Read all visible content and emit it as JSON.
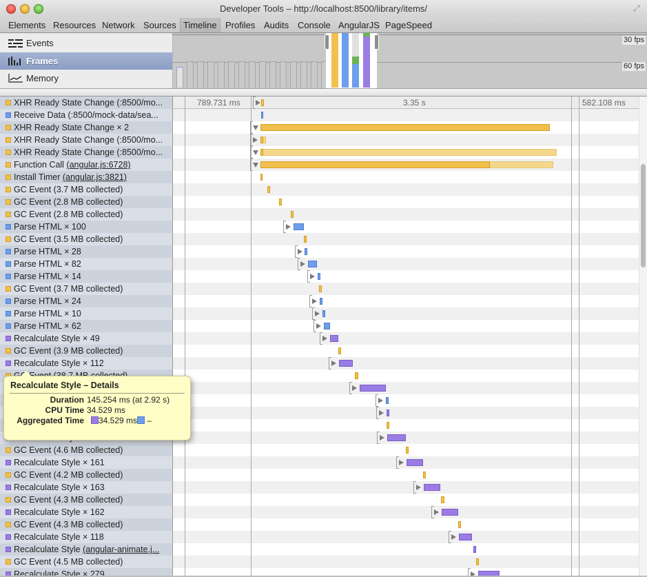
{
  "window": {
    "title": "Developer Tools – http://localhost:8500/library/items/"
  },
  "tabs": [
    {
      "label": "Elements",
      "active": false
    },
    {
      "label": "Resources",
      "active": false
    },
    {
      "label": "Network",
      "active": false
    },
    {
      "label": "Sources",
      "active": false
    },
    {
      "label": "Timeline",
      "active": true
    },
    {
      "label": "Profiles",
      "active": false
    },
    {
      "label": "Audits",
      "active": false
    },
    {
      "label": "Console",
      "active": false
    },
    {
      "label": "AngularJS",
      "active": false
    },
    {
      "label": "PageSpeed",
      "active": false
    }
  ],
  "overview": {
    "items": [
      {
        "label": "Events",
        "icon": "events-icon",
        "selected": false
      },
      {
        "label": "Frames",
        "icon": "frames-icon",
        "selected": true
      },
      {
        "label": "Memory",
        "icon": "memory-icon",
        "selected": false
      }
    ],
    "fps_labels": [
      "30 fps",
      "60 fps"
    ]
  },
  "colors": {
    "loading": "#6d9eeb",
    "scripting": "#f2c04e",
    "rendering": "#9a7ce5",
    "painting": "#6cb453",
    "row_alt": "#cdd3dc",
    "selected_item": "#8b9dc3",
    "tooltip_bg": "#fefec6"
  },
  "ruler": {
    "left_label": "789.731 ms",
    "center_label": "3.35 s",
    "right_label": "582.108 ms"
  },
  "records": [
    {
      "category": "scripting",
      "text": "XHR Ready State Change (:8500/mo...",
      "link": ""
    },
    {
      "category": "loading",
      "text": "Receive Data (:8500/mock-data/sea...",
      "link": ""
    },
    {
      "category": "scripting",
      "text": "XHR Ready State Change × 2",
      "link": ""
    },
    {
      "category": "scripting",
      "text": "XHR Ready State Change (:8500/mo...",
      "link": ""
    },
    {
      "category": "scripting",
      "text": "XHR Ready State Change (:8500/mo...",
      "link": ""
    },
    {
      "category": "scripting",
      "text": "Function Call ",
      "link": "(angular.js:6728)"
    },
    {
      "category": "scripting",
      "text": "Install Timer ",
      "link": "(angular.js:3821)"
    },
    {
      "category": "scripting",
      "text": "GC Event (3.7 MB collected)",
      "link": ""
    },
    {
      "category": "scripting",
      "text": "GC Event (2.8 MB collected)",
      "link": ""
    },
    {
      "category": "scripting",
      "text": "GC Event (2.8 MB collected)",
      "link": ""
    },
    {
      "category": "loading",
      "text": "Parse HTML × 100",
      "link": ""
    },
    {
      "category": "scripting",
      "text": "GC Event (3.5 MB collected)",
      "link": ""
    },
    {
      "category": "loading",
      "text": "Parse HTML × 28",
      "link": ""
    },
    {
      "category": "loading",
      "text": "Parse HTML × 82",
      "link": ""
    },
    {
      "category": "loading",
      "text": "Parse HTML × 14",
      "link": ""
    },
    {
      "category": "scripting",
      "text": "GC Event (3.7 MB collected)",
      "link": ""
    },
    {
      "category": "loading",
      "text": "Parse HTML × 24",
      "link": ""
    },
    {
      "category": "loading",
      "text": "Parse HTML × 10",
      "link": ""
    },
    {
      "category": "loading",
      "text": "Parse HTML × 62",
      "link": ""
    },
    {
      "category": "rendering",
      "text": "Recalculate Style × 49",
      "link": ""
    },
    {
      "category": "scripting",
      "text": "GC Event (3.9 MB collected)",
      "link": ""
    },
    {
      "category": "rendering",
      "text": "Recalculate Style × 112",
      "link": ""
    },
    {
      "category": "scripting",
      "text": "GC Event (38.7 MB collected)",
      "link": ""
    },
    {
      "category": "rendering",
      "text": "",
      "link": ""
    },
    {
      "category": "loading",
      "text": "",
      "link": ""
    },
    {
      "category": "rendering",
      "text": "",
      "link": ""
    },
    {
      "category": "scripting",
      "text": "",
      "link": ""
    },
    {
      "category": "rendering",
      "text": "Recalculate Style × 172",
      "link": ""
    },
    {
      "category": "scripting",
      "text": "GC Event (4.6 MB collected)",
      "link": ""
    },
    {
      "category": "rendering",
      "text": "Recalculate Style × 161",
      "link": ""
    },
    {
      "category": "scripting",
      "text": "GC Event (4.2 MB collected)",
      "link": ""
    },
    {
      "category": "rendering",
      "text": "Recalculate Style × 163",
      "link": ""
    },
    {
      "category": "scripting",
      "text": "GC Event (4.3 MB collected)",
      "link": ""
    },
    {
      "category": "rendering",
      "text": "Recalculate Style × 162",
      "link": ""
    },
    {
      "category": "scripting",
      "text": "GC Event (4.3 MB collected)",
      "link": ""
    },
    {
      "category": "rendering",
      "text": "Recalculate Style × 118",
      "link": ""
    },
    {
      "category": "rendering",
      "text": "Recalculate Style ",
      "link": "(angular-animate.j..."
    },
    {
      "category": "scripting",
      "text": "GC Event (4.5 MB collected)",
      "link": ""
    },
    {
      "category": "rendering",
      "text": "Recalculate Style × 279",
      "link": ""
    }
  ],
  "tooltip": {
    "title": "Recalculate Style – Details",
    "rows": [
      {
        "key": "Duration",
        "value": "145.254 ms (at 2.92 s)"
      },
      {
        "key": "CPU Time",
        "value": "34.529 ms"
      },
      {
        "key": "Aggregated Time",
        "value": "34.529 ms",
        "suffix": "–"
      }
    ]
  }
}
